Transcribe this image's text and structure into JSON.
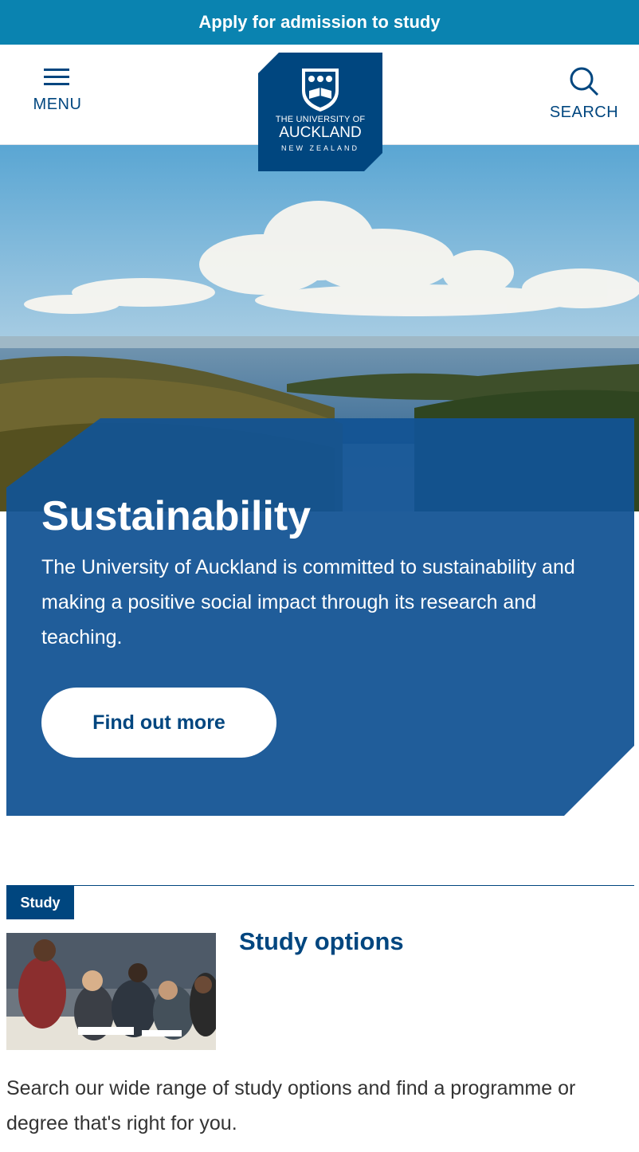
{
  "banner": {
    "label": "Apply for admission to study"
  },
  "header": {
    "menu_label": "MENU",
    "search_label": "SEARCH",
    "logo": {
      "line1": "THE UNIVERSITY OF",
      "line2": "AUCKLAND",
      "line3": "NEW ZEALAND"
    }
  },
  "hero": {
    "title": "Sustainability",
    "text": "The University of Auckland is committed to sustainability and making a positive social impact through its research and teaching.",
    "button_label": "Find out more"
  },
  "card": {
    "tag": "Study",
    "title": "Study options",
    "description": "Search our wide range of study options and find a programme or degree that's right for you."
  },
  "colors": {
    "brand": "#00467f",
    "banner": "#0a83b0",
    "panel": "#125394"
  },
  "icons": [
    "hamburger-icon",
    "search-icon",
    "university-crest-icon"
  ]
}
